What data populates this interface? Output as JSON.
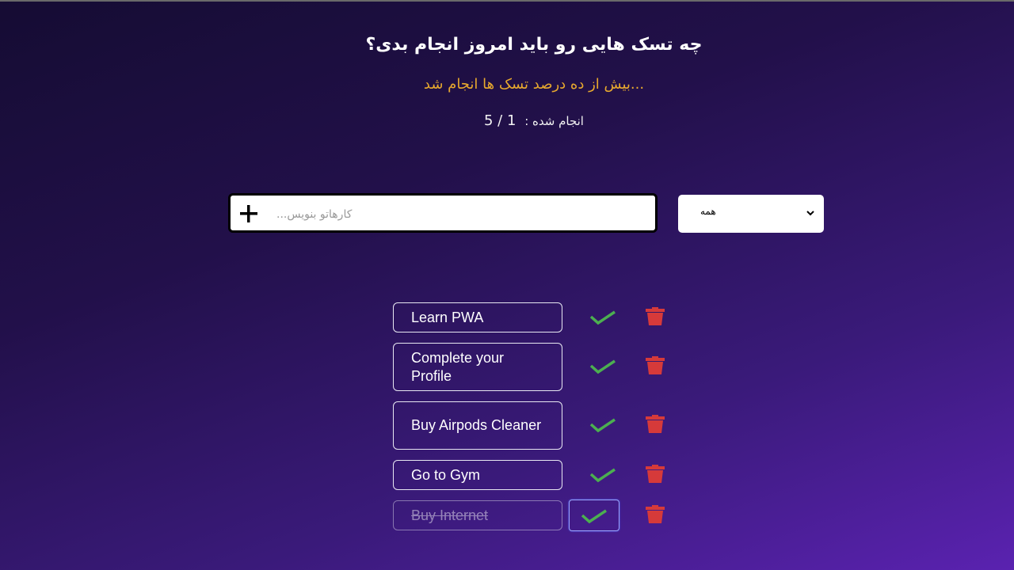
{
  "header": {
    "title": "چه تسک هایی رو باید امروز انجام بدی؟",
    "subtitle": "...بیش از ده درصد تسک ها انجام شد",
    "progress_label": "انجام شده :",
    "progress_count": "1 / 5"
  },
  "form": {
    "input_placeholder": "کارهاتو بنویس...",
    "input_value": "",
    "add_icon": "plus-icon",
    "filter_selected": "همه"
  },
  "todos": [
    {
      "text": "Learn PWA",
      "completed": false
    },
    {
      "text": "Complete your Profile",
      "completed": false
    },
    {
      "text": "Buy Airpods Cleaner",
      "completed": false
    },
    {
      "text": "Go to Gym",
      "completed": false
    },
    {
      "text": "Buy Internet",
      "completed": true
    }
  ],
  "colors": {
    "accent_text": "#e8a92e",
    "check": "#4caf50",
    "trash": "#d63a3a"
  }
}
